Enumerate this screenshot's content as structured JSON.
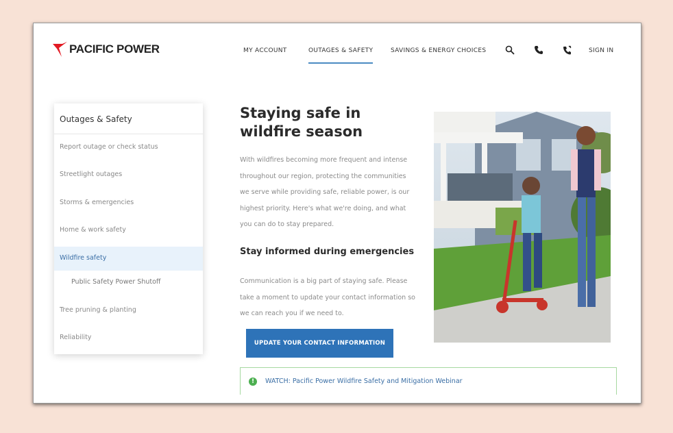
{
  "brand": {
    "name": "PACIFIC POWER",
    "color": "#e21a23"
  },
  "nav": {
    "items": [
      {
        "label": "MY ACCOUNT"
      },
      {
        "label": "OUTAGES & SAFETY",
        "active": true
      },
      {
        "label": "SAVINGS & ENERGY CHOICES"
      }
    ],
    "icons": [
      "search-icon",
      "phone-icon",
      "phone-mobile-icon"
    ],
    "sign_in": "SIGN IN",
    "accent": "#4a8bc2"
  },
  "sidebar": {
    "title": "Outages & Safety",
    "items": [
      {
        "label": "Report outage or check status"
      },
      {
        "label": "Streetlight outages"
      },
      {
        "label": "Storms & emergencies"
      },
      {
        "label": "Home & work safety"
      },
      {
        "label": "Wildfire safety",
        "active": true
      },
      {
        "label": "Public Safety Power Shutoff",
        "sub": true
      },
      {
        "label": "Tree pruning & planting"
      },
      {
        "label": "Reliability"
      }
    ]
  },
  "main": {
    "title": "Staying safe in wildfire season",
    "intro_lines": [
      "With wildfires becoming more frequent and intense",
      "throughout our region, protecting the communities",
      "we serve while providing safe, reliable power, is our",
      "highest priority. Here's what we're doing, and what",
      "you can do to stay prepared."
    ],
    "subheading": "Stay informed during emergencies",
    "comm_lines": [
      "Communication is a big part of staying safe. Please",
      "take a moment to update your contact information so",
      "we can reach you if we need to."
    ],
    "cta_label": "UPDATE YOUR CONTACT INFORMATION",
    "cta_color": "#2e73b8",
    "watch_label": "WATCH: Pacific Power Wildfire Safety and Mitigation Webinar"
  }
}
